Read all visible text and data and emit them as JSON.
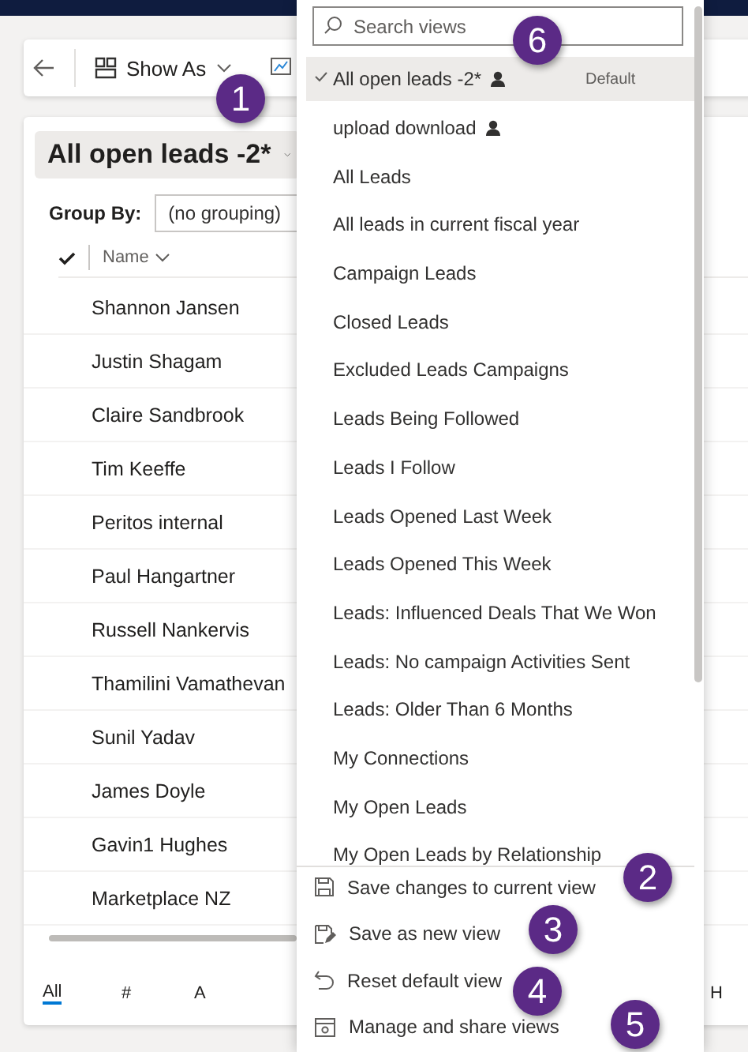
{
  "command_bar": {
    "show_as": "Show As"
  },
  "view_title": "All open leads -2*",
  "group_by": {
    "label": "Group By:",
    "value": "(no grouping)"
  },
  "grid": {
    "columns": [
      "Name"
    ],
    "rows": [
      "Shannon Jansen",
      "Justin Shagam",
      "Claire Sandbrook",
      "Tim Keeffe",
      "Peritos internal",
      "Paul Hangartner",
      "Russell Nankervis",
      "Thamilini Vamathevan",
      "Sunil Yadav",
      "James Doyle",
      "Gavin1 Hughes",
      "Marketplace NZ"
    ]
  },
  "alphabet": [
    {
      "label": "All",
      "selected": true
    },
    {
      "label": "#",
      "selected": false
    },
    {
      "label": "A",
      "selected": false
    },
    {
      "label": "H",
      "selected": false
    }
  ],
  "views_menu": {
    "search": {
      "placeholder": "Search views"
    },
    "items": [
      {
        "label": "All open leads -2*",
        "selected": true,
        "personal": true,
        "tag": "Default"
      },
      {
        "label": "upload download",
        "selected": false,
        "personal": true
      },
      {
        "label": "All Leads",
        "selected": false,
        "personal": false
      },
      {
        "label": "All leads in current fiscal year",
        "selected": false,
        "personal": false
      },
      {
        "label": "Campaign Leads",
        "selected": false,
        "personal": false
      },
      {
        "label": "Closed Leads",
        "selected": false,
        "personal": false
      },
      {
        "label": "Excluded Leads Campaigns",
        "selected": false,
        "personal": false
      },
      {
        "label": "Leads Being Followed",
        "selected": false,
        "personal": false
      },
      {
        "label": "Leads I Follow",
        "selected": false,
        "personal": false
      },
      {
        "label": "Leads Opened Last Week",
        "selected": false,
        "personal": false
      },
      {
        "label": "Leads Opened This Week",
        "selected": false,
        "personal": false
      },
      {
        "label": "Leads: Influenced Deals That We Won",
        "selected": false,
        "personal": false
      },
      {
        "label": "Leads: No campaign Activities Sent",
        "selected": false,
        "personal": false
      },
      {
        "label": "Leads: Older Than 6 Months",
        "selected": false,
        "personal": false
      },
      {
        "label": "My Connections",
        "selected": false,
        "personal": false
      },
      {
        "label": "My Open Leads",
        "selected": false,
        "personal": false
      },
      {
        "label": "My Open Leads by Relationship",
        "selected": false,
        "personal": false
      }
    ],
    "actions": [
      {
        "label": "Save changes to current view",
        "kind": "save"
      },
      {
        "label": "Save as new view",
        "kind": "save-as"
      },
      {
        "label": "Reset default view",
        "kind": "reset"
      },
      {
        "label": "Manage and share views",
        "kind": "manage"
      }
    ]
  },
  "annotations": [
    "1",
    "6",
    "2",
    "3",
    "4",
    "5"
  ]
}
